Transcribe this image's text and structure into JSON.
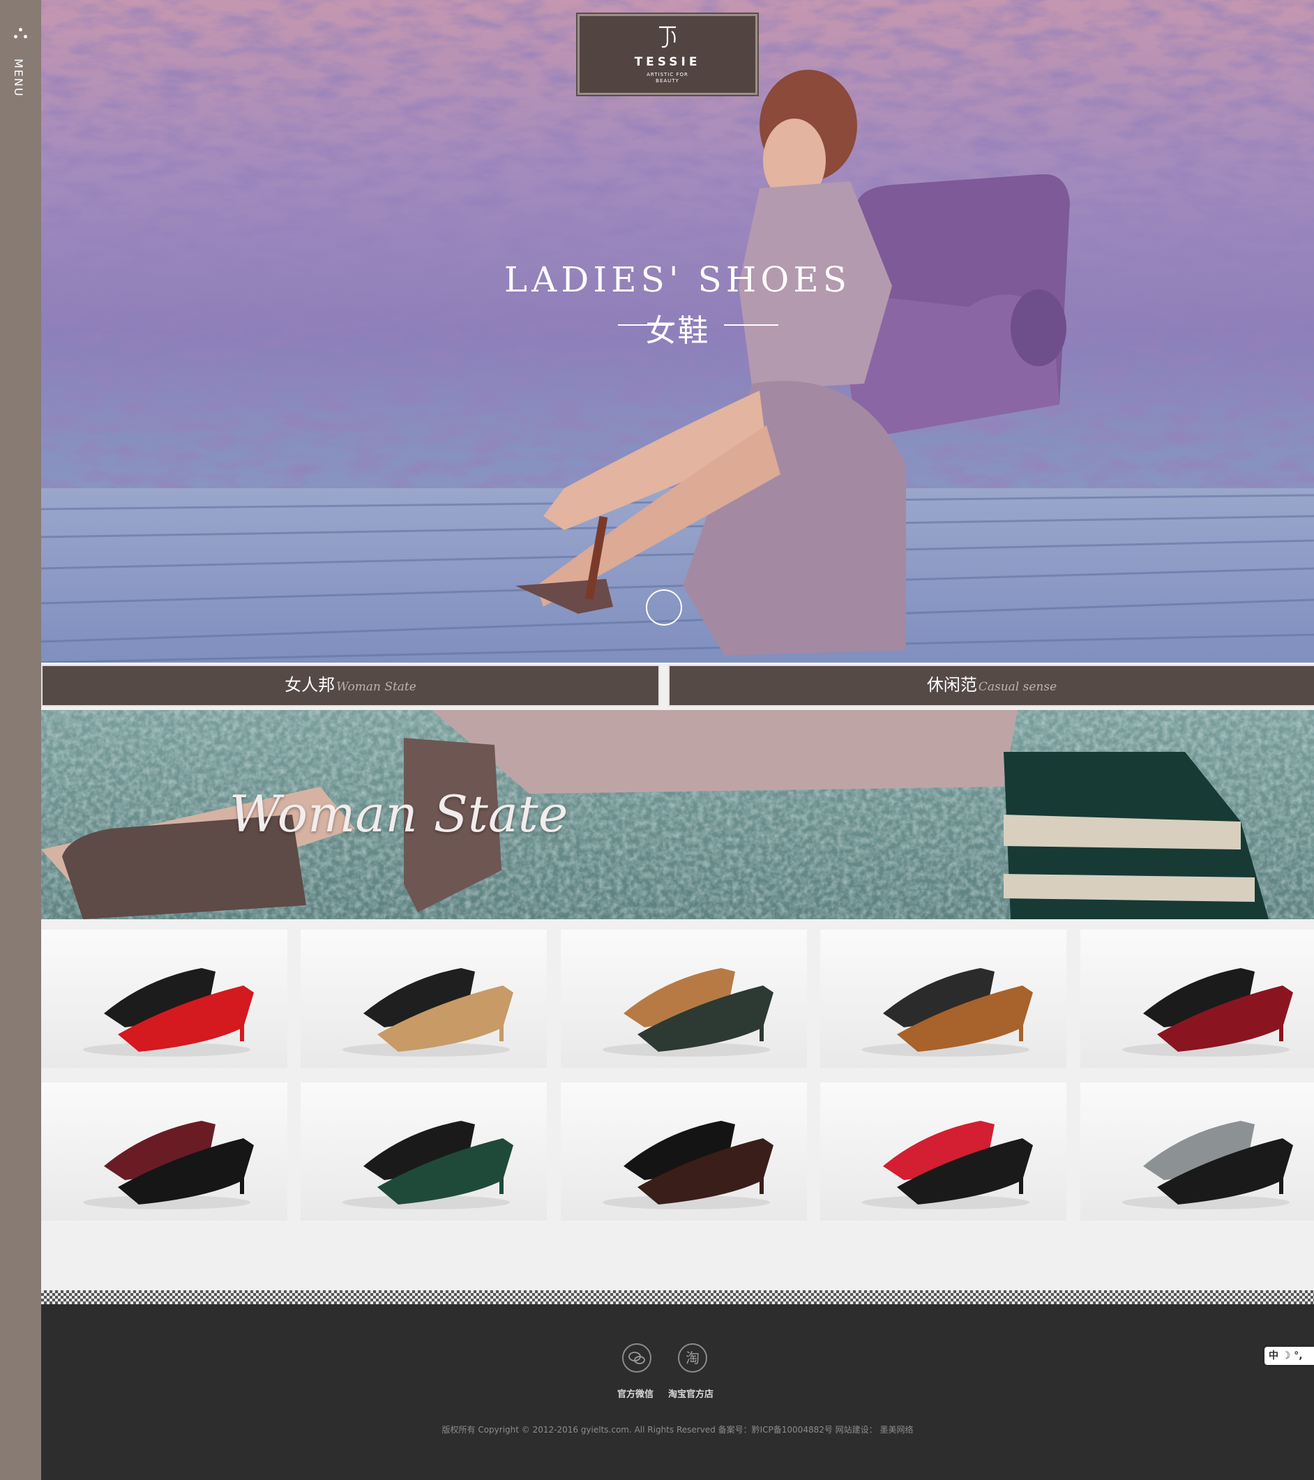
{
  "nav": {
    "menu_label": "MENU"
  },
  "logo": {
    "name": "TESSIE",
    "tagline": "ARTISTIC FOR BEAUTY"
  },
  "hero": {
    "title": "LADIES' SHOES",
    "subtitle": "女鞋"
  },
  "tabs": [
    {
      "cn": "女人邦",
      "en": "Woman State"
    },
    {
      "cn": "休闲范",
      "en": "Casual sense"
    }
  ],
  "banner": {
    "title": "Woman State"
  },
  "products": [
    {
      "name": "red-black-pointed-heels"
    },
    {
      "name": "lace-up-ankle-boots"
    },
    {
      "name": "platform-brogue-loafers"
    },
    {
      "name": "brogue-slip-ons"
    },
    {
      "name": "fur-trim-flats"
    },
    {
      "name": "patent-pointed-pumps"
    },
    {
      "name": "mary-jane-block-heels"
    },
    {
      "name": "tassel-loafers"
    },
    {
      "name": "red-bow-ballet-flats"
    },
    {
      "name": "grey-bow-pointed-flats"
    }
  ],
  "footer": {
    "wechat_label": "官方微信",
    "taobao_label": "淘宝官方店",
    "taobao_glyph": "淘",
    "copyright": "版权所有 Copyright © 2012-2016 gyielts.com. All Rights Reserved 备案号：黔ICP备10004882号     网站建设： 墨美网络"
  },
  "lang_widget": {
    "text": "中 ☽ °,"
  },
  "colors": {
    "rail": "#877b74",
    "tab_bg": "#564a47",
    "footer_bg": "#2e2d2d",
    "logo_bg": "#524440"
  }
}
